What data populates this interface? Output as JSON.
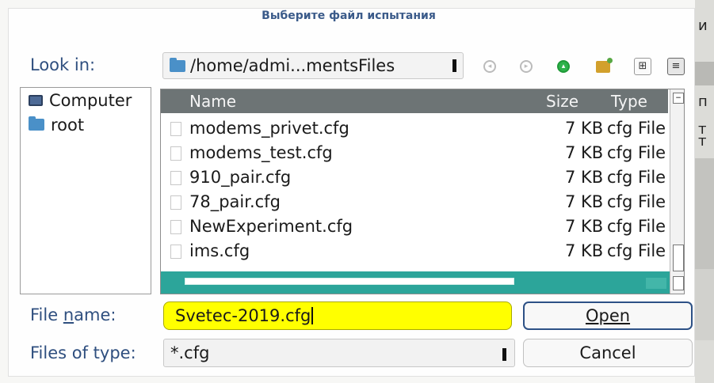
{
  "dialog": {
    "title": "Выберите файл испытания"
  },
  "background": {
    "right_edge_chars": [
      "и",
      "п",
      "т",
      "т"
    ]
  },
  "look_in": {
    "label": "Look in:",
    "path": "/home/admi...mentsFiles"
  },
  "toolbar": {
    "icons": [
      "back-icon",
      "forward-icon",
      "up-icon",
      "new-folder-icon",
      "detail-view-icon",
      "list-view-icon"
    ]
  },
  "sidebar": {
    "items": [
      {
        "label": "Computer",
        "icon": "computer-icon"
      },
      {
        "label": "root",
        "icon": "folder-icon"
      }
    ]
  },
  "file_list": {
    "columns": {
      "name": "Name",
      "size": "Size",
      "type": "Type"
    },
    "rows": [
      {
        "name": "modems_privet.cfg",
        "size": "7 KB",
        "type": "cfg File"
      },
      {
        "name": "modems_test.cfg",
        "size": "7 KB",
        "type": "cfg File"
      },
      {
        "name": "910_pair.cfg",
        "size": "7 KB",
        "type": "cfg File"
      },
      {
        "name": "78_pair.cfg",
        "size": "7 KB",
        "type": "cfg File"
      },
      {
        "name": "NewExperiment.cfg",
        "size": "7 KB",
        "type": "cfg File"
      },
      {
        "name": "ims.cfg",
        "size": "7 KB",
        "type": "cfg File"
      }
    ]
  },
  "file_name": {
    "label_before": "File ",
    "label_mnemonic": "n",
    "label_after": "ame:",
    "value": "Svetec-2019.cfg"
  },
  "file_type": {
    "label": "Files of type:",
    "value": "*.cfg"
  },
  "buttons": {
    "open": "Open",
    "cancel": "Cancel"
  },
  "colors": {
    "title": "#3b5b8a",
    "labels": "#2f4f7f",
    "filename_highlight": "#ffff00",
    "header_bg": "#6d7475",
    "hscroll": "#2ca59a",
    "open_border": "#2d5186"
  }
}
